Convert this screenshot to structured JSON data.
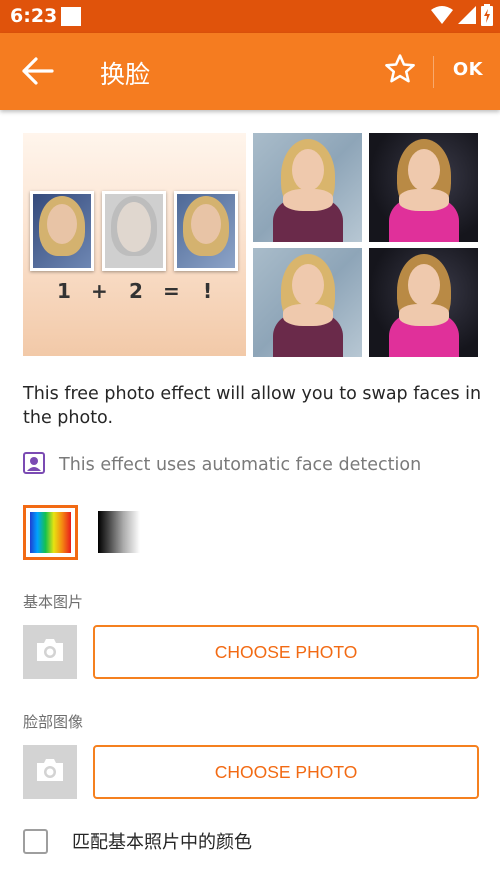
{
  "status_bar": {
    "time": "6:23",
    "icons": [
      "notification-square-icon",
      "wifi-icon",
      "cellular-signal-icon",
      "battery-charging-icon"
    ]
  },
  "app_bar": {
    "back_icon": "arrow-back-icon",
    "title": "换脸",
    "favorite_icon": "star-outline-icon",
    "ok_label": "OK"
  },
  "preview": {
    "equation": [
      "1",
      "+",
      "2",
      "=",
      "!"
    ]
  },
  "description": "This free photo effect will allow you to swap faces in the photo.",
  "auto_detection": {
    "icon": "face-detection-icon",
    "text": "This effect uses automatic face detection"
  },
  "color_modes": {
    "selected": "color",
    "options": [
      "color",
      "black-and-white"
    ]
  },
  "base_photo": {
    "label": "基本图片",
    "camera_icon": "camera-icon",
    "button_label": "CHOOSE PHOTO"
  },
  "face_image": {
    "label": "脸部图像",
    "camera_icon": "camera-icon",
    "button_label": "CHOOSE PHOTO"
  },
  "match_color": {
    "checked": false,
    "label": "匹配基本照片中的颜色"
  },
  "colors": {
    "status_bar": "#e0530b",
    "app_bar": "#f57c20",
    "accent": "#f26a13",
    "placeholder_grey": "#d3d3d3"
  }
}
